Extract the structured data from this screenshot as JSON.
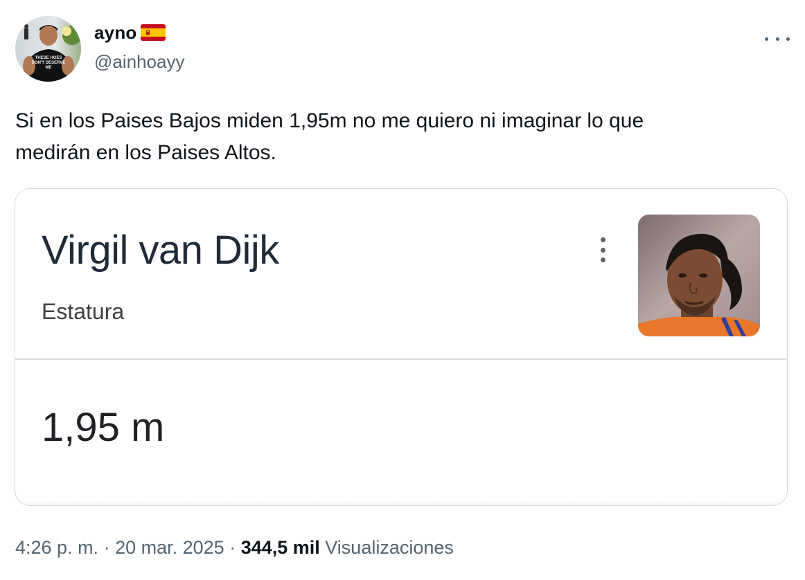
{
  "author": {
    "display_name": "ayno",
    "handle": "@ainhoayy",
    "avatar_shirt_text": "THESE HOES DON'T DESERVE ME"
  },
  "tweet": {
    "text": "Si en los Paises Bajos miden 1,95m no me quiero ni imaginar lo que\nmedirán en los Paises Altos."
  },
  "card": {
    "title": "Virgil van Dijk",
    "subtitle": "Estatura",
    "value": "1,95 m"
  },
  "meta": {
    "time": "4:26 p. m.",
    "separator_1": " · ",
    "date": "20 mar. 2025",
    "separator_2": " · ",
    "views_count": "344,5 mil",
    "views_label": " Visualizaciones"
  },
  "icons": {
    "flag": "spain-flag-icon",
    "more": "more-options-icon",
    "card_menu": "kebab-menu-icon"
  },
  "colors": {
    "text_primary": "#0f1419",
    "text_secondary": "#536471",
    "card_border": "#cfd9de",
    "flag_red": "#c60b1e",
    "flag_yellow": "#ffc400"
  }
}
